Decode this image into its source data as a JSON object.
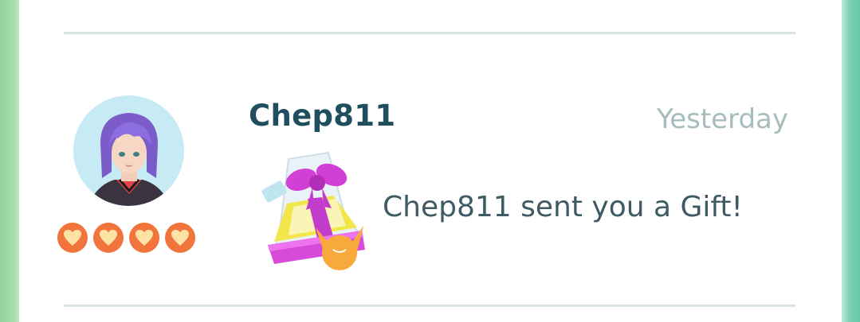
{
  "friend": {
    "name": "Chep811",
    "timestamp": "Yesterday",
    "message": "Chep811 sent you a Gift!",
    "friendship_hearts": 4
  },
  "icons": {
    "avatar": "trainer-avatar",
    "hearts": "friendship-heart-icon",
    "gift": "gift-icon"
  },
  "colors": {
    "name_text": "#1f4f5e",
    "timestamp_text": "#a7bcbc",
    "message_text": "#3e5b64",
    "heart_badge": "#f0743b",
    "avatar_bg": "#c7ebf5"
  }
}
